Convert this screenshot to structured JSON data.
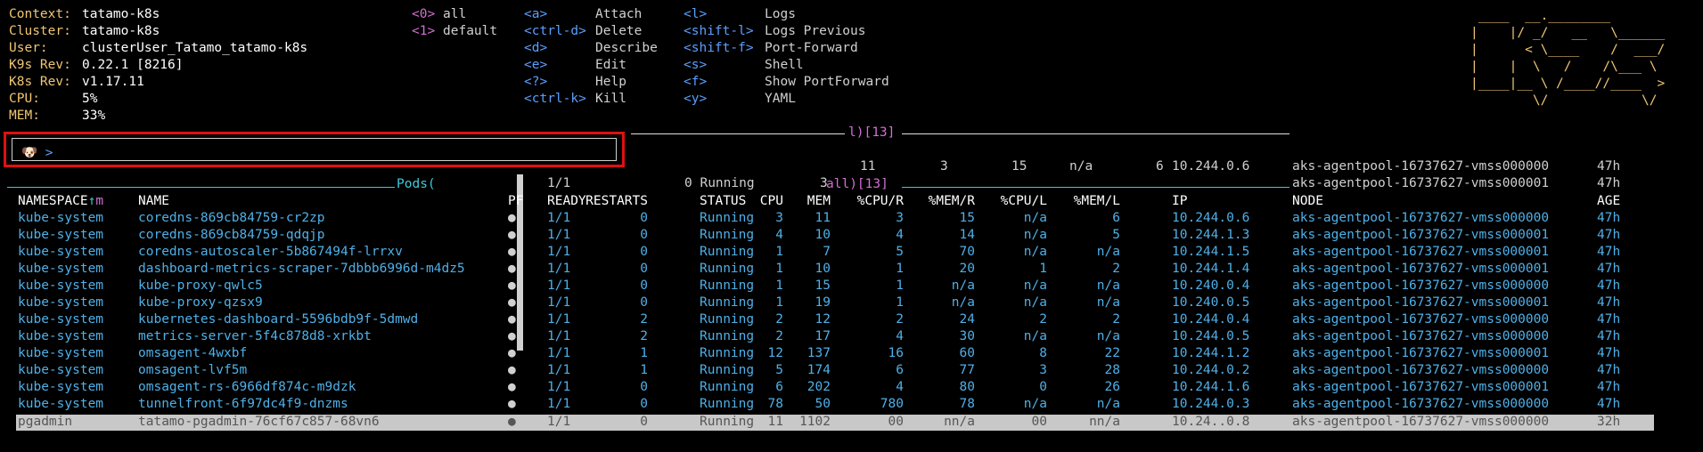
{
  "info": [
    {
      "label": "Context:",
      "value": "tatamo-k8s"
    },
    {
      "label": "Cluster:",
      "value": "tatamo-k8s"
    },
    {
      "label": "User:",
      "value": "clusterUser_Tatamo_tatamo-k8s"
    },
    {
      "label": "K9s Rev:",
      "value": "0.22.1 [8216]"
    },
    {
      "label": "K8s Rev:",
      "value": "v1.17.11"
    },
    {
      "label": "CPU:",
      "value": "5%"
    },
    {
      "label": "MEM:",
      "value": "33%"
    }
  ],
  "namespaces": [
    {
      "key": "<0>",
      "label": "all"
    },
    {
      "key": "<1>",
      "label": "default"
    }
  ],
  "hotkeys_col1": [
    {
      "key": "<a>",
      "label": "Attach"
    },
    {
      "key": "<ctrl-d>",
      "label": "Delete"
    },
    {
      "key": "<d>",
      "label": "Describe"
    },
    {
      "key": "<e>",
      "label": "Edit"
    },
    {
      "key": "<?>",
      "label": "Help"
    },
    {
      "key": "<ctrl-k>",
      "label": "Kill"
    }
  ],
  "hotkeys_col2": [
    {
      "key": "<l>",
      "label": "Logs"
    },
    {
      "key": "<shift-l>",
      "label": "Logs Previous"
    },
    {
      "key": "<shift-f>",
      "label": "Port-Forward"
    },
    {
      "key": "<s>",
      "label": "Shell"
    },
    {
      "key": "<f>",
      "label": "Show PortForward"
    },
    {
      "key": "<y>",
      "label": "YAML"
    }
  ],
  "logo_lines": [
    " ____  __.________       ",
    "|    |/ _/   __   \\______",
    "|      < \\____    /  ___/",
    "|    |  \\   /    /\\___ \\ ",
    "|____|__ \\ /____//____  >",
    "        \\/            \\/ "
  ],
  "command": {
    "icon": "🐶",
    "prompt": ">",
    "value": ""
  },
  "pods_title": "Pods(",
  "pods_title_tail": "all)[13]",
  "behind_title_tail": "l)[13]",
  "ghost_row": [
    "11",
    "3",
    "15",
    "n/a",
    "6",
    "10.244.0.6",
    "aks-agentpool-16737627-vmss000000",
    "47h"
  ],
  "ghost_row2": [
    "1/1",
    "0 Running",
    "3"
  ],
  "ghost_node2": "aks-agentpool-16737627-vmss000001",
  "ghost_age2": "47h",
  "columns": [
    "NAMESPACE↑m",
    "NAME",
    "PF",
    "READY",
    "RESTARTS",
    "STATUS",
    "CPU",
    "MEM",
    "%CPU/R",
    "%MEM/R",
    "%CPU/L",
    "%MEM/L",
    "IP",
    "NODE",
    "AGE"
  ],
  "rows": [
    [
      "kube-system",
      "coredns-869cb84759-cr2zp",
      "●",
      "1/1",
      "0",
      "Running",
      "3",
      "11",
      "3",
      "15",
      "n/a",
      "6",
      "10.244.0.6",
      "aks-agentpool-16737627-vmss000000",
      "47h"
    ],
    [
      "kube-system",
      "coredns-869cb84759-qdqjp",
      "●",
      "1/1",
      "0",
      "Running",
      "4",
      "10",
      "4",
      "14",
      "n/a",
      "5",
      "10.244.1.3",
      "aks-agentpool-16737627-vmss000001",
      "47h"
    ],
    [
      "kube-system",
      "coredns-autoscaler-5b867494f-lrrxv",
      "●",
      "1/1",
      "0",
      "Running",
      "1",
      "7",
      "5",
      "70",
      "n/a",
      "n/a",
      "10.244.1.5",
      "aks-agentpool-16737627-vmss000001",
      "47h"
    ],
    [
      "kube-system",
      "dashboard-metrics-scraper-7dbbb6996d-m4dz5",
      "●",
      "1/1",
      "0",
      "Running",
      "1",
      "10",
      "1",
      "20",
      "1",
      "2",
      "10.244.1.4",
      "aks-agentpool-16737627-vmss000001",
      "47h"
    ],
    [
      "kube-system",
      "kube-proxy-qwlc5",
      "●",
      "1/1",
      "0",
      "Running",
      "1",
      "15",
      "1",
      "n/a",
      "n/a",
      "n/a",
      "10.240.0.4",
      "aks-agentpool-16737627-vmss000000",
      "47h"
    ],
    [
      "kube-system",
      "kube-proxy-qzsx9",
      "●",
      "1/1",
      "0",
      "Running",
      "1",
      "19",
      "1",
      "n/a",
      "n/a",
      "n/a",
      "10.240.0.5",
      "aks-agentpool-16737627-vmss000001",
      "47h"
    ],
    [
      "kube-system",
      "kubernetes-dashboard-5596bdb9f-5dmwd",
      "●",
      "1/1",
      "2",
      "Running",
      "2",
      "12",
      "2",
      "24",
      "2",
      "2",
      "10.244.0.4",
      "aks-agentpool-16737627-vmss000000",
      "47h"
    ],
    [
      "kube-system",
      "metrics-server-5f4c878d8-xrkbt",
      "●",
      "1/1",
      "2",
      "Running",
      "2",
      "17",
      "4",
      "30",
      "n/a",
      "n/a",
      "10.244.0.5",
      "aks-agentpool-16737627-vmss000000",
      "47h"
    ],
    [
      "kube-system",
      "omsagent-4wxbf",
      "●",
      "1/1",
      "1",
      "Running",
      "12",
      "137",
      "16",
      "60",
      "8",
      "22",
      "10.244.1.2",
      "aks-agentpool-16737627-vmss000001",
      "47h"
    ],
    [
      "kube-system",
      "omsagent-lvf5m",
      "●",
      "1/1",
      "1",
      "Running",
      "5",
      "174",
      "6",
      "77",
      "3",
      "28",
      "10.244.0.2",
      "aks-agentpool-16737627-vmss000000",
      "47h"
    ],
    [
      "kube-system",
      "omsagent-rs-6966df874c-m9dzk",
      "●",
      "1/1",
      "0",
      "Running",
      "6",
      "202",
      "4",
      "80",
      "0",
      "26",
      "10.244.1.6",
      "aks-agentpool-16737627-vmss000001",
      "47h"
    ],
    [
      "kube-system",
      "tunnelfront-6f97dc4f9-dnzms",
      "●",
      "1/1",
      "0",
      "Running",
      "78",
      "50",
      "780",
      "78",
      "n/a",
      "n/a",
      "10.244.0.3",
      "aks-agentpool-16737627-vmss000000",
      "47h"
    ]
  ],
  "selected_row": [
    "pgadmin",
    "tatamo-pgadmin-76cf67c857-68vn6",
    "●",
    "1/1",
    "0",
    "Running",
    "11",
    "1102",
    "00",
    "nn/a",
    "00",
    "nn/a",
    "10.24..0.8",
    "aks-agentpool-16737627-vmss000000",
    "32h"
  ]
}
